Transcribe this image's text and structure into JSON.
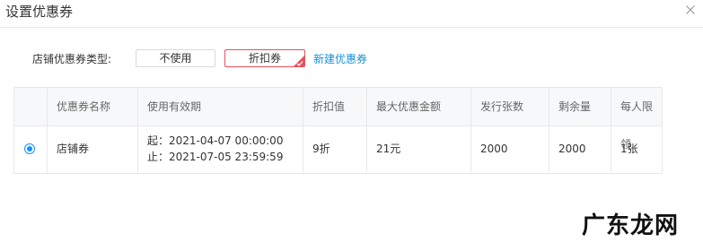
{
  "dialog": {
    "title": "设置优惠券"
  },
  "coupon_type": {
    "label": "店铺优惠券类型:",
    "options": [
      "不使用",
      "折扣券"
    ],
    "selected": "折扣券",
    "new_link": "新建优惠券"
  },
  "table": {
    "headers": [
      "",
      "优惠券名称",
      "使用有效期",
      "折扣值",
      "最大优惠金额",
      "发行张数",
      "剩余量",
      "每人限领"
    ],
    "rows": [
      {
        "selected": true,
        "name": "店铺券",
        "valid_from": "起：2021-04-07 00:00:00",
        "valid_to": "止：2021-07-05 23:59:59",
        "discount": "9折",
        "max_amount": "21元",
        "issued": "2000",
        "remaining": "2000",
        "limit": "1张"
      }
    ]
  },
  "watermark": {
    "text": "广东龙网"
  },
  "colors": {
    "accent_red": "#e9505d",
    "link_blue": "#1890d8",
    "radio_blue": "#1890ff"
  }
}
